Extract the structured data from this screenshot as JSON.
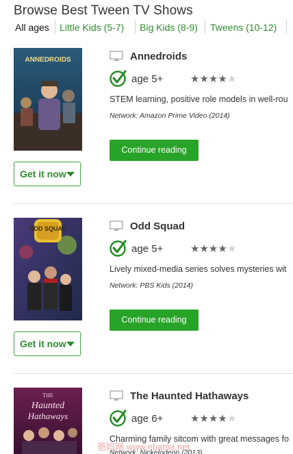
{
  "page": {
    "title": "Browse Best Tween TV Shows",
    "filters": [
      {
        "label": "All ages",
        "active": true
      },
      {
        "label": "Little Kids (5-7)",
        "active": false
      },
      {
        "label": "Big Kids (8-9)",
        "active": false
      },
      {
        "label": "Tweens (10-12)",
        "active": false
      }
    ]
  },
  "shows": [
    {
      "title": "Annedroids",
      "age": "age 5+",
      "rating": 4,
      "rating_max": 5,
      "description": "STEM learning, positive role models in well-rou",
      "network_label": "Network:",
      "network": "Amazon Prime Video",
      "year": "(2014)",
      "continue_label": "Continue reading",
      "get_label": "Get it now",
      "poster_text": "ANNEDROIDS"
    },
    {
      "title": "Odd Squad",
      "age": "age 5+",
      "rating": 4,
      "rating_max": 5,
      "description": "Lively mixed-media series solves mysteries wit",
      "network_label": "Network:",
      "network": "PBS Kids",
      "year": "(2014)",
      "continue_label": "Continue reading",
      "get_label": "Get it now",
      "poster_text": "ODD SQUAD"
    },
    {
      "title": "The Haunted Hathaways",
      "age": "age 6+",
      "rating": 4,
      "rating_max": 5,
      "description": "Charming family sitcom with great messages fo",
      "network_label": "Network:",
      "network": "Nickelodeon",
      "year": "(2013)",
      "poster_text_1": "THE",
      "poster_text_2": "Haunted",
      "poster_text_3": "Hathaways"
    }
  ],
  "watermark": "爸妈网 www.ebama.net",
  "colors": {
    "accent": "#27a327",
    "link": "#2e8b2e",
    "check": "#1f8a1f"
  },
  "icons": {
    "tv": "tv-icon",
    "check": "check-circle-icon",
    "caret": "caret-down-icon",
    "star": "star-icon"
  }
}
